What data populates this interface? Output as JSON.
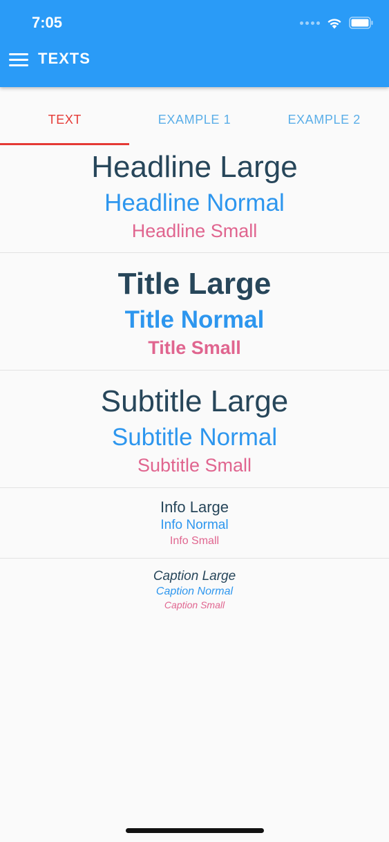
{
  "status_bar": {
    "time": "7:05"
  },
  "app_bar": {
    "title": "TEXTS",
    "menu_icon": "hamburger-menu-icon",
    "background_color": "#2a9bf7"
  },
  "tabs": [
    {
      "label": "TEXT",
      "active": true
    },
    {
      "label": "EXAMPLE 1",
      "active": false
    },
    {
      "label": "EXAMPLE 2",
      "active": false
    }
  ],
  "colors": {
    "dark": "#27465a",
    "blue": "#2d96ee",
    "pink": "#e0658f",
    "active_tab": "#e53935"
  },
  "sections": {
    "headline": {
      "large": "Headline Large",
      "normal": "Headline Normal",
      "small": "Headline Small"
    },
    "title": {
      "large": "Title Large",
      "normal": "Title Normal",
      "small": "Title Small"
    },
    "subtitle": {
      "large": "Subtitle Large",
      "normal": "Subtitle Normal",
      "small": "Subtitle Small"
    },
    "info": {
      "large": "Info Large",
      "normal": "Info Normal",
      "small": "Info Small"
    },
    "caption": {
      "large": "Caption Large",
      "normal": "Caption Normal",
      "small": "Caption Small"
    }
  }
}
